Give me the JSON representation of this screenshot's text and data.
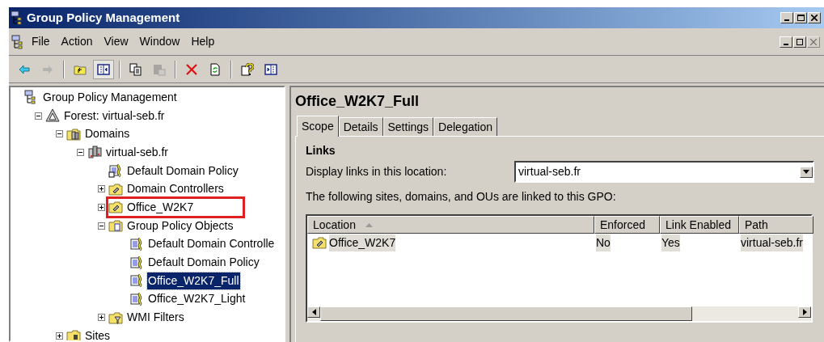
{
  "window": {
    "title": "Group Policy Management"
  },
  "menu": [
    "File",
    "Action",
    "View",
    "Window",
    "Help"
  ],
  "toolbar": [
    {
      "kind": "back",
      "disabled": false
    },
    {
      "kind": "forward",
      "disabled": true
    },
    {
      "kind": "sep"
    },
    {
      "kind": "up",
      "disabled": false
    },
    {
      "kind": "tree",
      "disabled": false,
      "selected": true
    },
    {
      "kind": "sep"
    },
    {
      "kind": "copy",
      "disabled": false
    },
    {
      "kind": "paste",
      "disabled": true
    },
    {
      "kind": "sep"
    },
    {
      "kind": "delete",
      "disabled": false
    },
    {
      "kind": "refresh",
      "disabled": false
    },
    {
      "kind": "sep"
    },
    {
      "kind": "help",
      "disabled": false
    },
    {
      "kind": "panel",
      "disabled": false
    }
  ],
  "tree": [
    {
      "label": "Group Policy Management",
      "kind": "console",
      "selected": false,
      "highlighted": false,
      "children": [
        {
          "label": "Forest: virtual-seb.fr",
          "kind": "forest",
          "expanded": true,
          "selected": false,
          "highlighted": false,
          "children": [
            {
              "label": "Domains",
              "kind": "domains",
              "expanded": true,
              "selected": false,
              "highlighted": false,
              "children": [
                {
                  "label": "virtual-seb.fr",
                  "kind": "domain",
                  "expanded": true,
                  "selected": false,
                  "highlighted": false,
                  "children": [
                    {
                      "label": "Default Domain Policy",
                      "kind": "link",
                      "selected": false,
                      "highlighted": false
                    },
                    {
                      "label": "Domain Controllers",
                      "kind": "ou",
                      "expanded": false,
                      "selected": false,
                      "highlighted": false
                    },
                    {
                      "label": "Office_W2K7",
                      "kind": "ou",
                      "expanded": false,
                      "selected": false,
                      "highlighted": true
                    },
                    {
                      "label": "Group Policy Objects",
                      "kind": "folder",
                      "expanded": true,
                      "selected": false,
                      "highlighted": false,
                      "children": [
                        {
                          "label": "Default Domain Controlle",
                          "kind": "gpo",
                          "selected": false,
                          "highlighted": false
                        },
                        {
                          "label": "Default Domain Policy",
                          "kind": "gpo",
                          "selected": false,
                          "highlighted": false
                        },
                        {
                          "label": "Office_W2K7_Full",
                          "kind": "gpo",
                          "selected": true,
                          "highlighted": false
                        },
                        {
                          "label": "Office_W2K7_Light",
                          "kind": "gpo",
                          "selected": false,
                          "highlighted": false
                        }
                      ]
                    },
                    {
                      "label": "WMI Filters",
                      "kind": "wmi",
                      "expanded": false,
                      "selected": false,
                      "highlighted": false
                    }
                  ]
                }
              ]
            },
            {
              "label": "Sites",
              "kind": "sites",
              "expanded": false,
              "selected": false,
              "highlighted": false
            }
          ]
        }
      ]
    }
  ],
  "details": {
    "title": "Office_W2K7_Full",
    "tabs": [
      {
        "label": "Scope",
        "selected": true
      },
      {
        "label": "Details",
        "selected": false
      },
      {
        "label": "Settings",
        "selected": false
      },
      {
        "label": "Delegation",
        "selected": false
      }
    ],
    "section": "Links",
    "location_label": "Display links in this location:",
    "location_value": "virtual-seb.fr",
    "list_caption": "The following sites, domains, and OUs are linked to this GPO:",
    "table": {
      "columns": [
        "Location",
        "Enforced",
        "Link Enabled",
        "Path"
      ],
      "rows": [
        {
          "cells": [
            "Office_W2K7",
            "No",
            "Yes",
            "virtual-seb.fr"
          ],
          "selected": true
        }
      ]
    }
  }
}
